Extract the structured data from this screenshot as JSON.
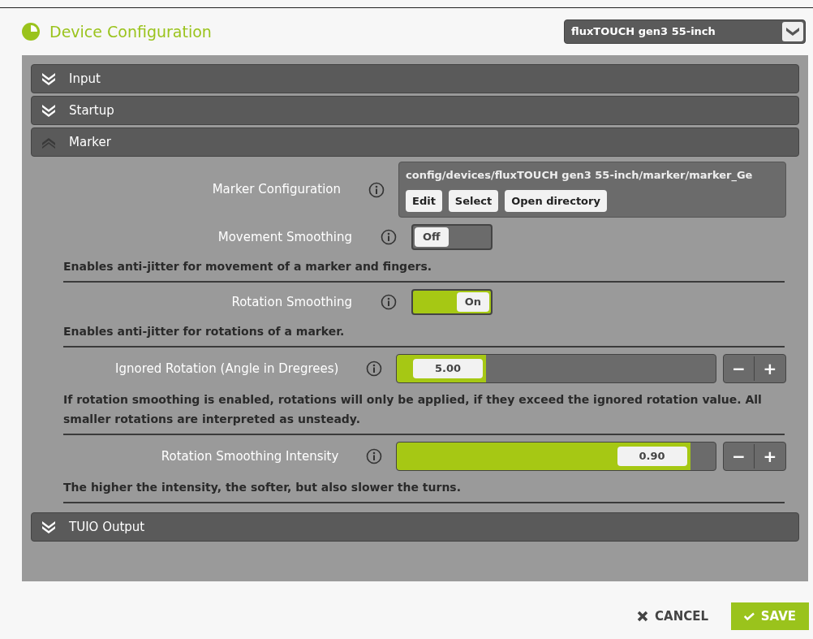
{
  "header": {
    "title": "Device Configuration",
    "device_select": {
      "value": "fluxTOUCH gen3 55-inch"
    }
  },
  "sections": [
    {
      "title": "Input",
      "expanded": false
    },
    {
      "title": "Startup",
      "expanded": false
    },
    {
      "title": "Marker",
      "expanded": true,
      "settings": [
        {
          "kind": "file",
          "label": "Marker Configuration",
          "path": "config/devices/fluxTOUCH gen3 55-inch/marker/marker_Ge",
          "buttons": [
            "Edit",
            "Select",
            "Open directory"
          ]
        },
        {
          "kind": "toggle",
          "label": "Movement Smoothing",
          "on": false,
          "state_label": "Off",
          "description": "Enables anti-jitter for movement of a marker and fingers."
        },
        {
          "kind": "toggle",
          "label": "Rotation Smoothing",
          "on": true,
          "state_label": "On",
          "description": "Enables anti-jitter for rotations of a marker."
        },
        {
          "kind": "slider",
          "label": "Ignored Rotation (Angle in Dregrees)",
          "level": 0.28,
          "reading": "5.00",
          "minus": "−",
          "plus": "+",
          "description": "If rotation smoothing is enabled, rotations will only be applied, if they exceed the ignored rotation value. All smaller rotations are interpreted as unsteady."
        },
        {
          "kind": "slider",
          "label": "Rotation Smoothing Intensity",
          "level": 0.92,
          "reading": "0.90",
          "minus": "−",
          "plus": "+",
          "description": "The higher the intensity, the softer, but also slower the turns."
        }
      ]
    },
    {
      "title": "TUIO Output",
      "expanded": false
    }
  ],
  "footer": {
    "cancel": "CANCEL",
    "save": "SAVE"
  }
}
